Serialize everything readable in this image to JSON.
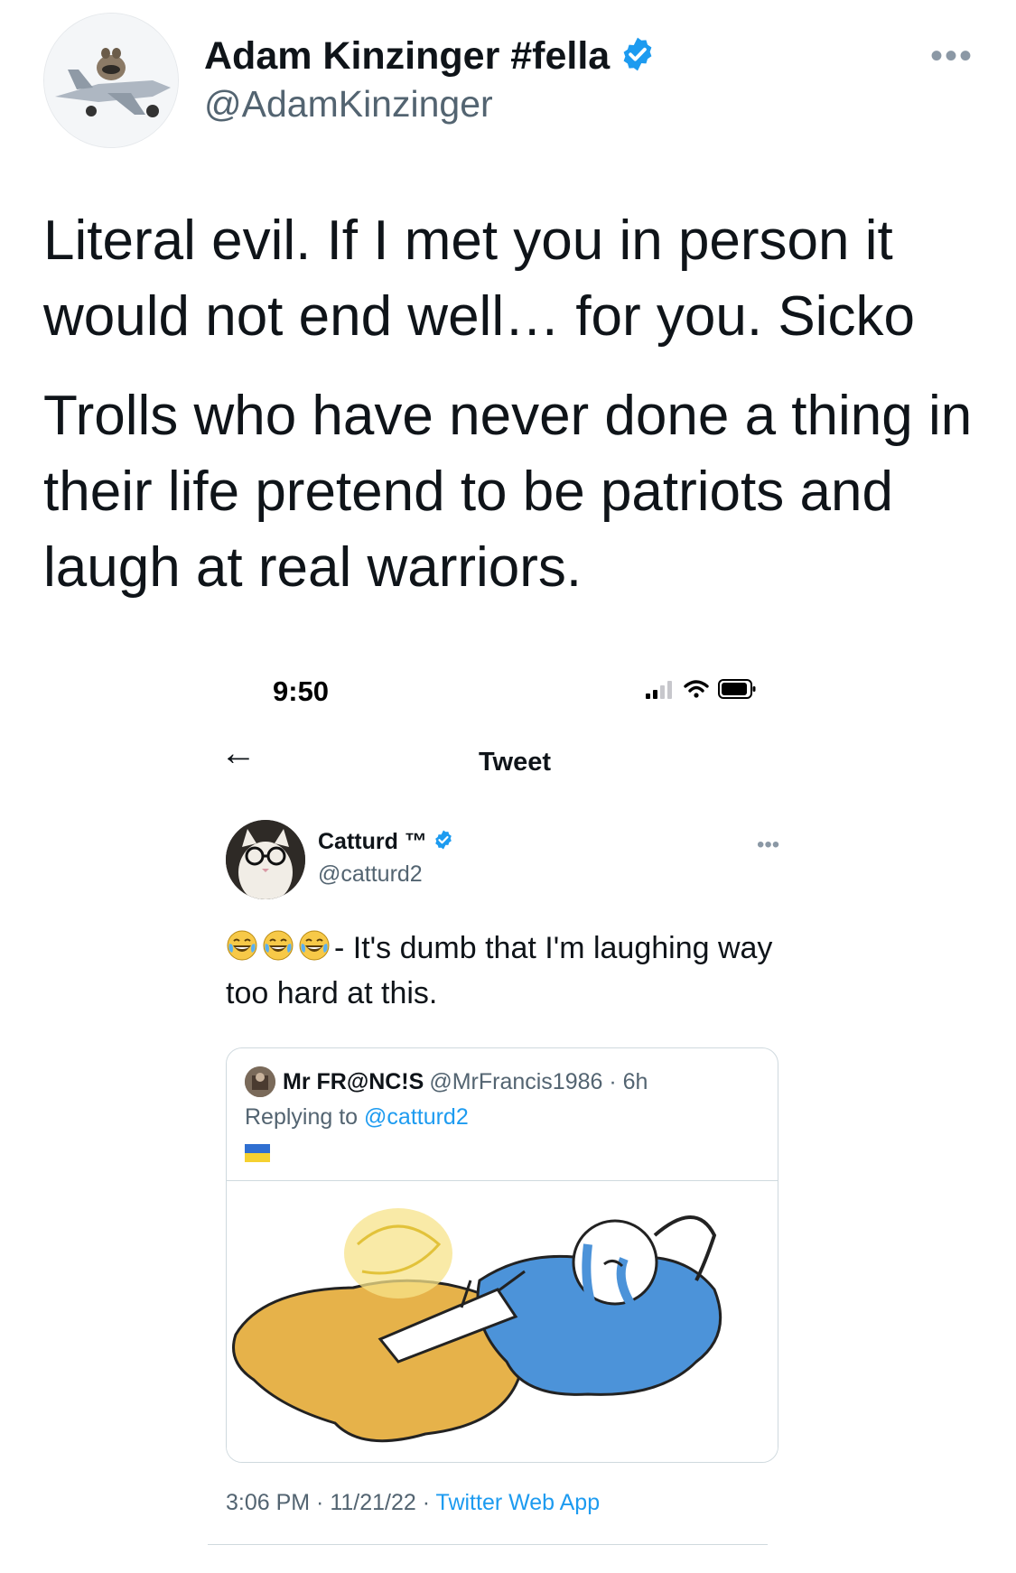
{
  "outer_tweet": {
    "display_name": "Adam Kinzinger #fella",
    "handle": "@AdamKinzinger",
    "more_label": "•••",
    "text_paragraphs": [
      "Literal evil.  If I met you in person it would not end well… for you.  Sicko",
      "Trolls who have never done a thing in their life pretend to be patriots and laugh at real warriors."
    ]
  },
  "screenshot": {
    "status_bar": {
      "time": "9:50"
    },
    "nav": {
      "back_icon": "←",
      "title": "Tweet"
    },
    "tweet": {
      "display_name": "Catturd ™",
      "handle": "@catturd2",
      "more_label": "•••",
      "emojis": [
        "😂",
        "😂",
        "😂"
      ],
      "text": "- It's dumb that I'm laughing way too hard at this."
    },
    "quote": {
      "display_name": "Mr FR@NC!S",
      "handle_time": "@MrFrancis1986 · 6h",
      "replying_prefix": "Replying to ",
      "replying_mention": "@catturd2",
      "flag_colors": [
        "#2f6fd1",
        "#f5d130"
      ]
    },
    "footer": {
      "datetime": "3:06 PM · 11/21/22 · ",
      "app": "Twitter Web App"
    }
  },
  "colors": {
    "verified": "#1d9bf0",
    "link": "#1d9bf0",
    "secondary_text": "#536471"
  }
}
